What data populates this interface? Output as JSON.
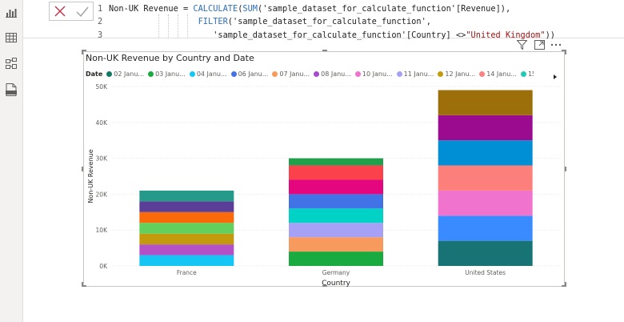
{
  "rail": {
    "icons": [
      "report-view-icon",
      "table-view-icon",
      "model-view-icon",
      "dax-query-view-icon"
    ]
  },
  "formula": {
    "lines": [
      {
        "num": "1",
        "segments": [
          {
            "t": "Non-UK Revenue = ",
            "c": "plain"
          },
          {
            "t": "CALCULATE",
            "c": "fn"
          },
          {
            "t": "(",
            "c": "plain"
          },
          {
            "t": "SUM",
            "c": "fn"
          },
          {
            "t": "(",
            "c": "plain"
          },
          {
            "t": "'sample_dataset_for_calculate_function'",
            "c": "plain"
          },
          {
            "t": "[Revenue]),",
            "c": "plain"
          }
        ]
      },
      {
        "num": "2",
        "segments": [
          {
            "t": "                  ",
            "c": "plain"
          },
          {
            "t": "FILTER",
            "c": "fn"
          },
          {
            "t": "('sample_dataset_for_calculate_function',",
            "c": "plain"
          }
        ]
      },
      {
        "num": "3",
        "segments": [
          {
            "t": "                     ",
            "c": "plain"
          },
          {
            "t": "'sample_dataset_for_calculate_function'[Country] <>",
            "c": "plain"
          },
          {
            "t": "\"United Kingdom\"",
            "c": "str"
          },
          {
            "t": "))",
            "c": "plain"
          }
        ]
      }
    ]
  },
  "visual_header": {
    "icons": [
      "filter-icon",
      "focus-mode-icon",
      "more-options-icon"
    ]
  },
  "chart_data": {
    "type": "bar",
    "stacked": true,
    "title": "Non-UK Revenue by Country and Date",
    "xlabel": "Country",
    "ylabel": "Non-UK Revenue",
    "ylim": [
      0,
      50000
    ],
    "yticks": [
      "0K",
      "10K",
      "20K",
      "30K",
      "40K",
      "50K"
    ],
    "categories": [
      "France",
      "Germany",
      "United States"
    ],
    "legend_title": "Date",
    "legend": [
      {
        "label": "02 Janu...",
        "color": "#117865"
      },
      {
        "label": "03 Janu...",
        "color": "#1aab40"
      },
      {
        "label": "04 Janu...",
        "color": "#15c6f4"
      },
      {
        "label": "06 Janu...",
        "color": "#4172e6"
      },
      {
        "label": "07 Janu...",
        "color": "#f79a5e"
      },
      {
        "label": "08 Janu...",
        "color": "#a949ce"
      },
      {
        "label": "10 Janu...",
        "color": "#f073cd"
      },
      {
        "label": "11 Janu...",
        "color": "#a7a0f7"
      },
      {
        "label": "12 Janu...",
        "color": "#c49a0d"
      },
      {
        "label": "14 Janu...",
        "color": "#f88380"
      },
      {
        "label": "15 Janu...",
        "color": "#22c9b7"
      }
    ],
    "stacks": [
      {
        "category": "France",
        "segments": [
          {
            "value": 3000,
            "color": "#15c6f4"
          },
          {
            "value": 3000,
            "color": "#b451c7"
          },
          {
            "value": 3000,
            "color": "#c49a0d"
          },
          {
            "value": 3000,
            "color": "#62d05c"
          },
          {
            "value": 3000,
            "color": "#fa6a09"
          },
          {
            "value": 3000,
            "color": "#5b3e97"
          },
          {
            "value": 3000,
            "color": "#25998a"
          }
        ]
      },
      {
        "category": "Germany",
        "segments": [
          {
            "value": 4000,
            "color": "#1aab40"
          },
          {
            "value": 4000,
            "color": "#f79a5e"
          },
          {
            "value": 4000,
            "color": "#a7a0f7"
          },
          {
            "value": 4000,
            "color": "#00d3c5"
          },
          {
            "value": 4000,
            "color": "#4172e6"
          },
          {
            "value": 4000,
            "color": "#e3067e"
          },
          {
            "value": 4000,
            "color": "#fb424c"
          },
          {
            "value": 2000,
            "color": "#20a04a"
          }
        ]
      },
      {
        "category": "United States",
        "segments": [
          {
            "value": 7000,
            "color": "#187374"
          },
          {
            "value": 7000,
            "color": "#3a8bff"
          },
          {
            "value": 7000,
            "color": "#f073cd"
          },
          {
            "value": 7000,
            "color": "#fd7f7c"
          },
          {
            "value": 7000,
            "color": "#008fd4"
          },
          {
            "value": 7000,
            "color": "#9b0b8f"
          },
          {
            "value": 7000,
            "color": "#9c6f0a"
          }
        ]
      }
    ]
  }
}
